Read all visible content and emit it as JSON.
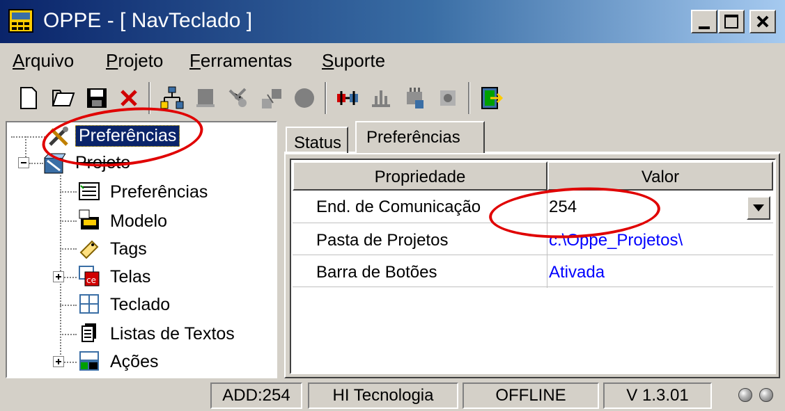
{
  "window": {
    "title": "OPPE - [ NavTeclado ]",
    "controls": {
      "minimize": "_",
      "maximize": "□",
      "close": "×"
    }
  },
  "menu": {
    "items": [
      {
        "first": "A",
        "rest": "rquivo"
      },
      {
        "first": "P",
        "rest": "rojeto"
      },
      {
        "first": "F",
        "rest": "erramentas"
      },
      {
        "first": "S",
        "rest": "uporte"
      }
    ]
  },
  "toolbar": {
    "icons": [
      "new-file-icon",
      "open-folder-icon",
      "save-disk-icon",
      "delete-x-icon",
      "network-icon",
      "stop-square-icon",
      "tools-icon",
      "transfer-icon",
      "record-circle-icon",
      "connect-plug-icon",
      "upload-icon",
      "chip-settings-icon",
      "chip-gear-icon",
      "exit-door-icon"
    ]
  },
  "tree": {
    "root_label": "Preferências",
    "project_label": "Projeto",
    "children": [
      "Preferências",
      "Modelo",
      "Tags",
      "Telas",
      "Teclado",
      "Listas de Textos",
      "Ações"
    ]
  },
  "tabs": {
    "status": "Status",
    "preferencias": "Preferências"
  },
  "grid": {
    "headers": {
      "prop": "Propriedade",
      "value": "Valor"
    },
    "rows": [
      {
        "prop": "End. de Comunicação",
        "value": "254"
      },
      {
        "prop": "Pasta de Projetos",
        "value": "c:\\Oppe_Projetos\\"
      },
      {
        "prop": "Barra de Botões",
        "value": "Ativada"
      }
    ]
  },
  "status": {
    "addr": "ADD:254",
    "company": "HI Tecnologia",
    "mode": "OFFLINE",
    "version": "V 1.3.01"
  },
  "colors": {
    "title_start": "#0a246a",
    "title_end": "#a6caf0",
    "link_blue": "#0000ff",
    "annotation_red": "#e00000"
  }
}
